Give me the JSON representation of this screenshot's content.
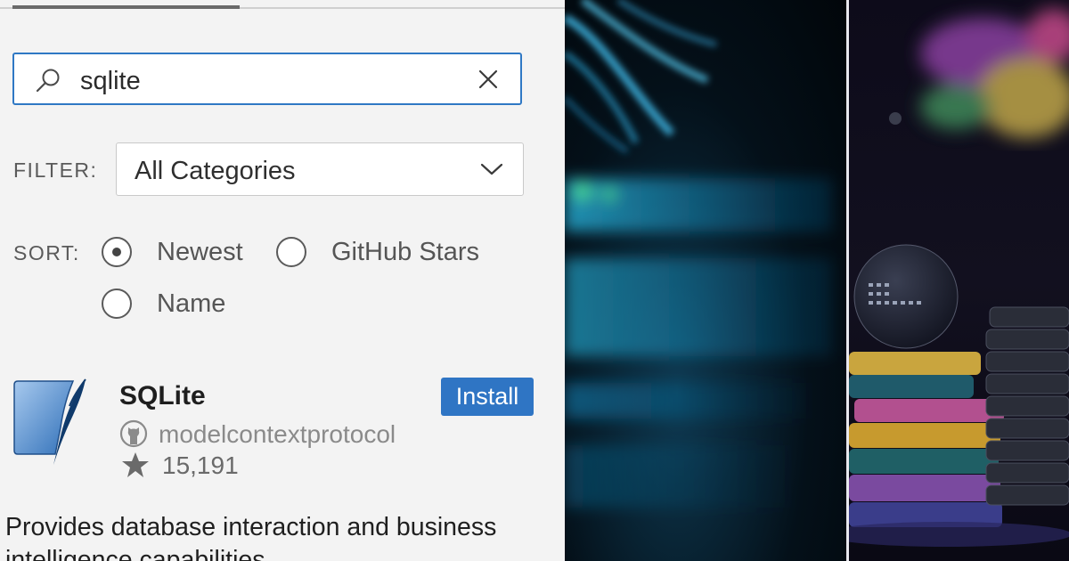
{
  "search": {
    "value": "sqlite",
    "icon": "search-icon"
  },
  "filter": {
    "label": "FILTER:",
    "selected": "All Categories"
  },
  "sort": {
    "label": "SORT:",
    "options": [
      {
        "label": "Newest",
        "checked": true
      },
      {
        "label": "GitHub Stars",
        "checked": false
      },
      {
        "label": "Name",
        "checked": false
      }
    ]
  },
  "result": {
    "title": "SQLite",
    "install_label": "Install",
    "author": "modelcontextprotocol",
    "stars": "15,191",
    "description": "Provides database interaction and business intelligence capabilities"
  },
  "colors": {
    "accent": "#2f75c4",
    "panel_bg": "#f3f3f3"
  }
}
